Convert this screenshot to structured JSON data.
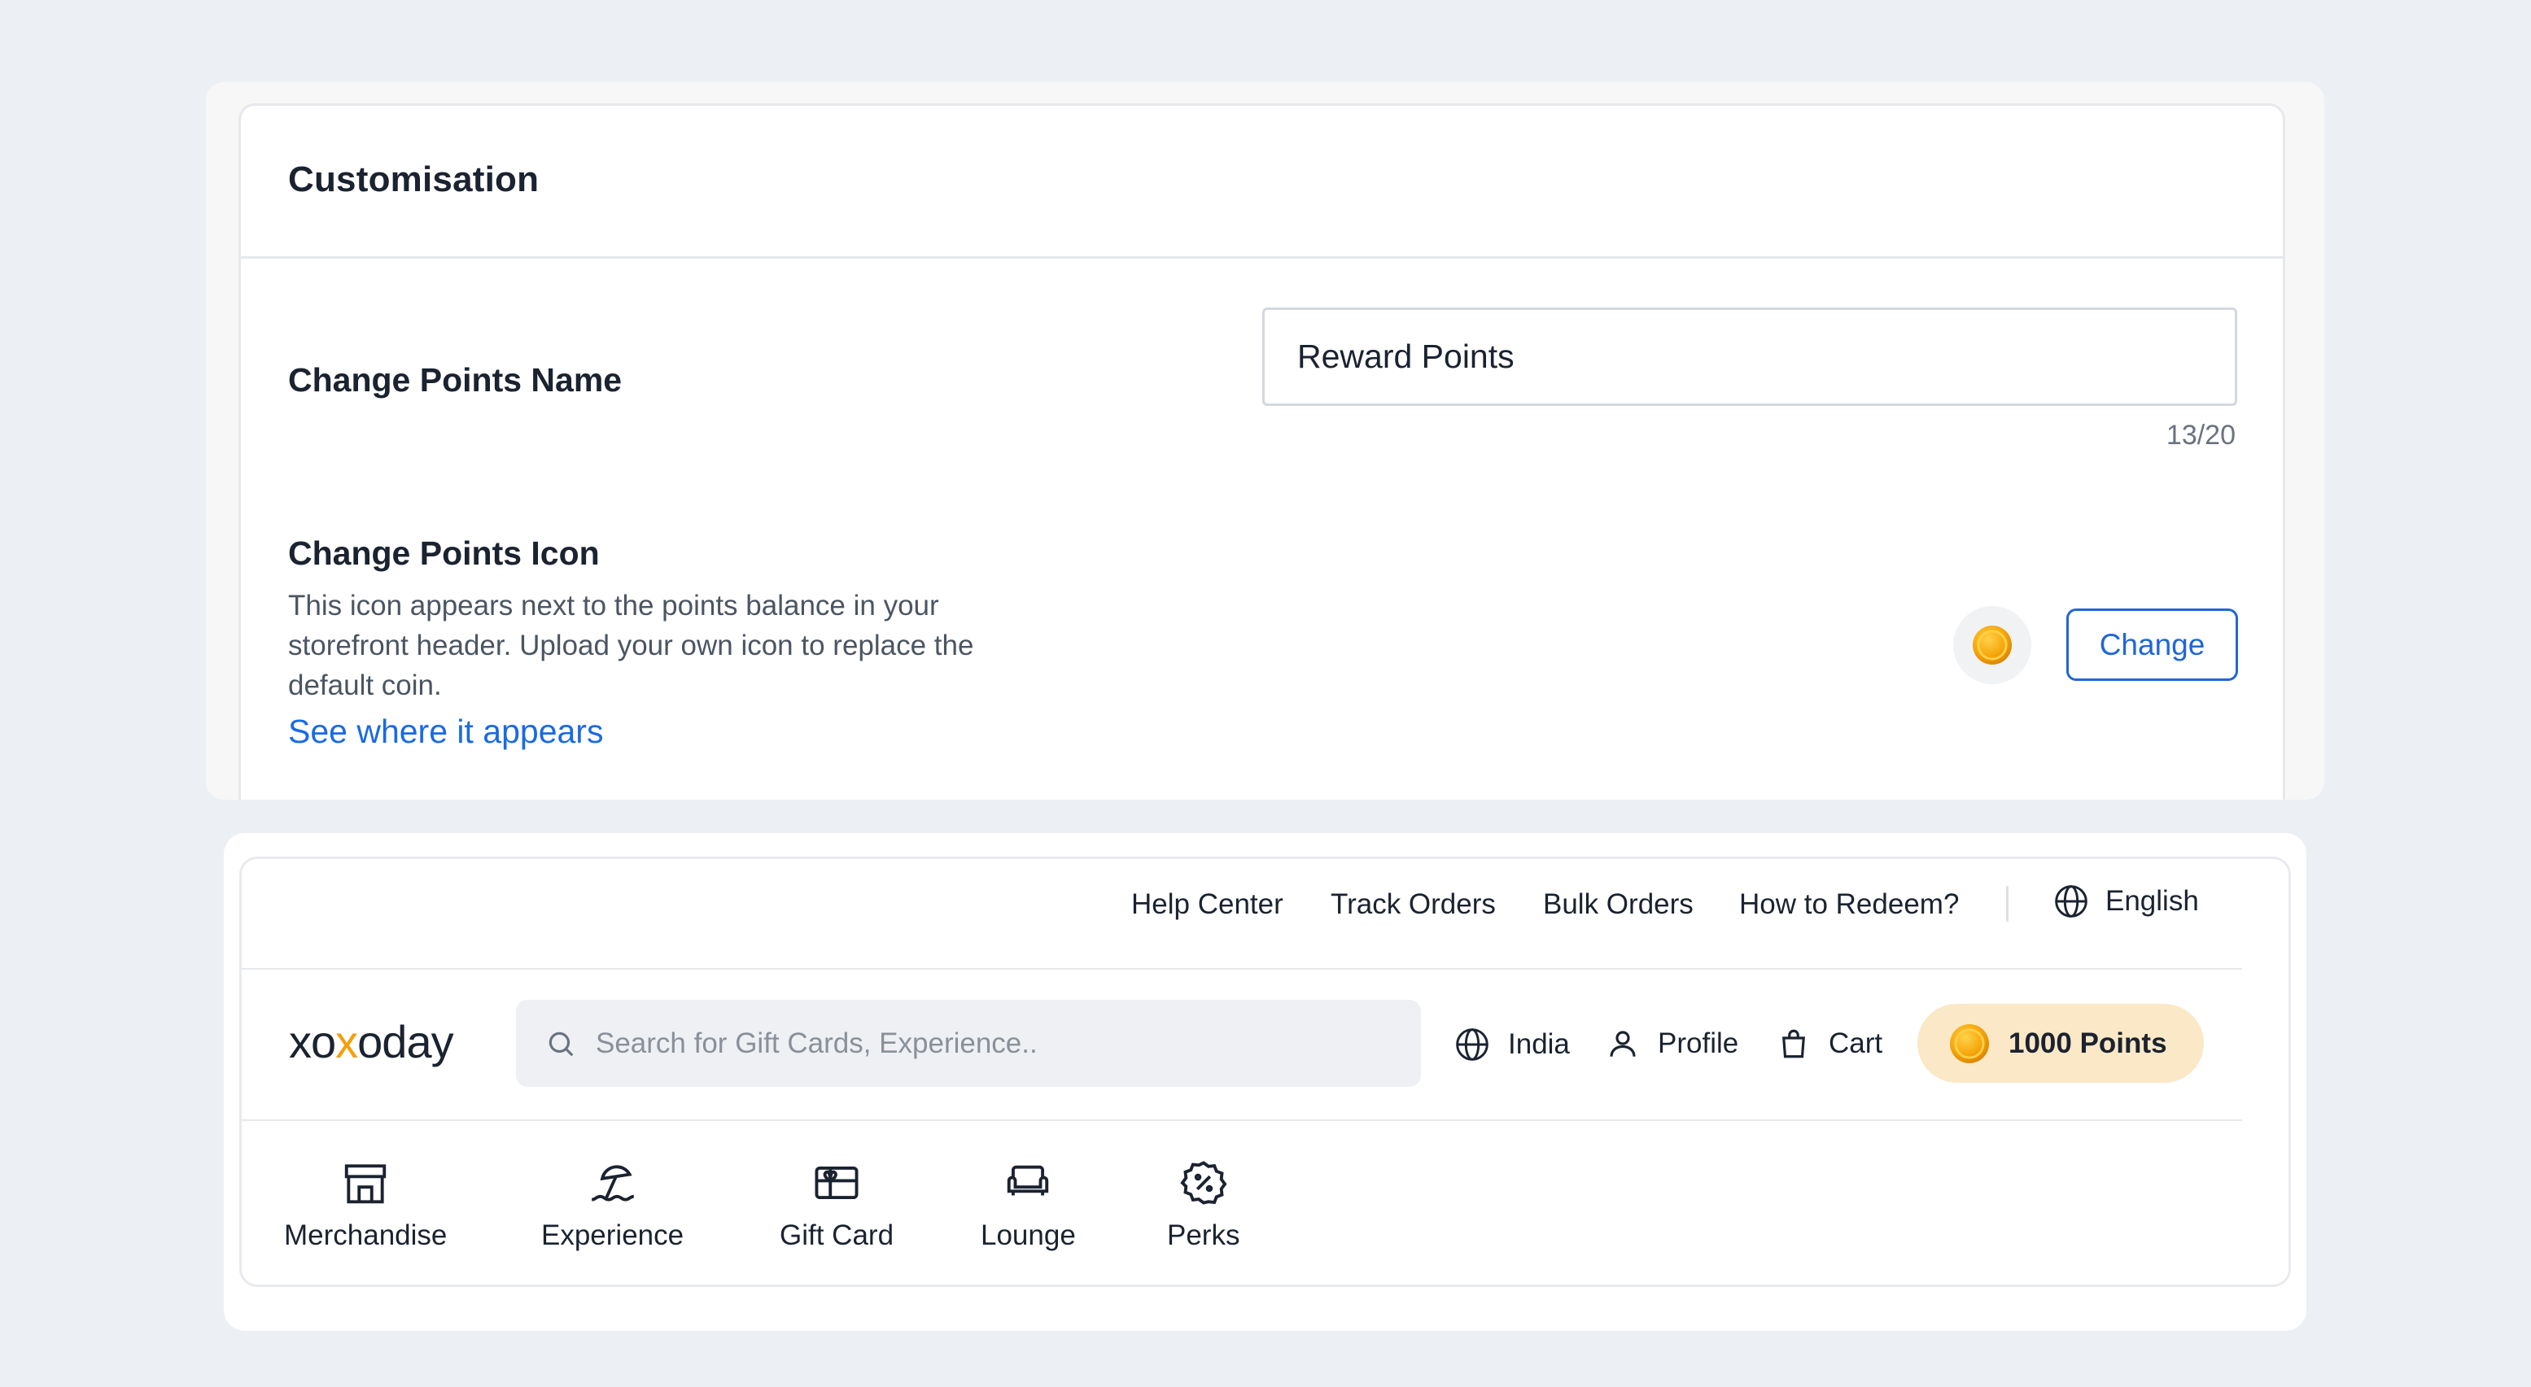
{
  "customisation": {
    "title": "Customisation",
    "points_name": {
      "label": "Change Points Name",
      "value": "Reward Points",
      "char_count": "13/20"
    },
    "points_icon": {
      "label": "Change Points Icon",
      "description": "This icon appears next to the points balance in your storefront header. Upload your own icon to replace the default coin.",
      "link_text": "See where it appears",
      "change_button": "Change",
      "icon": "coin-icon"
    }
  },
  "storefront": {
    "utility_links": [
      "Help Center",
      "Track Orders",
      "Bulk Orders",
      "How to Redeem?"
    ],
    "language": "English",
    "logo": {
      "p1": "xo",
      "p2": "x",
      "p3": "oday"
    },
    "search_placeholder": "Search for Gift Cards, Experience..",
    "country": "India",
    "profile": "Profile",
    "cart": "Cart",
    "points_balance": "1000 Points",
    "categories": [
      {
        "label": "Merchandise",
        "icon": "store-icon"
      },
      {
        "label": "Experience",
        "icon": "beach-umbrella-icon"
      },
      {
        "label": "Gift Card",
        "icon": "gift-card-icon"
      },
      {
        "label": "Lounge",
        "icon": "sofa-icon"
      },
      {
        "label": "Perks",
        "icon": "discount-badge-icon"
      }
    ]
  },
  "colors": {
    "accent_blue": "#1a6ae3",
    "points_pill": "#fbe8c6",
    "coin_gold": "#f5a70c",
    "page_bg": "#ecf0f4"
  }
}
